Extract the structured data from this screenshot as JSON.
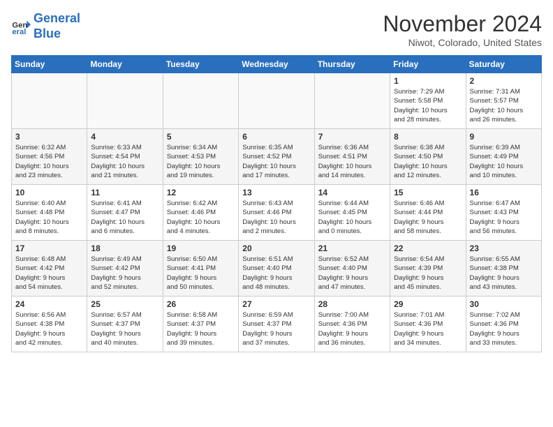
{
  "header": {
    "logo_line1": "General",
    "logo_line2": "Blue",
    "month": "November 2024",
    "location": "Niwot, Colorado, United States"
  },
  "weekdays": [
    "Sunday",
    "Monday",
    "Tuesday",
    "Wednesday",
    "Thursday",
    "Friday",
    "Saturday"
  ],
  "weeks": [
    [
      {
        "day": "",
        "info": ""
      },
      {
        "day": "",
        "info": ""
      },
      {
        "day": "",
        "info": ""
      },
      {
        "day": "",
        "info": ""
      },
      {
        "day": "",
        "info": ""
      },
      {
        "day": "1",
        "info": "Sunrise: 7:29 AM\nSunset: 5:58 PM\nDaylight: 10 hours\nand 28 minutes."
      },
      {
        "day": "2",
        "info": "Sunrise: 7:31 AM\nSunset: 5:57 PM\nDaylight: 10 hours\nand 26 minutes."
      }
    ],
    [
      {
        "day": "3",
        "info": "Sunrise: 6:32 AM\nSunset: 4:56 PM\nDaylight: 10 hours\nand 23 minutes."
      },
      {
        "day": "4",
        "info": "Sunrise: 6:33 AM\nSunset: 4:54 PM\nDaylight: 10 hours\nand 21 minutes."
      },
      {
        "day": "5",
        "info": "Sunrise: 6:34 AM\nSunset: 4:53 PM\nDaylight: 10 hours\nand 19 minutes."
      },
      {
        "day": "6",
        "info": "Sunrise: 6:35 AM\nSunset: 4:52 PM\nDaylight: 10 hours\nand 17 minutes."
      },
      {
        "day": "7",
        "info": "Sunrise: 6:36 AM\nSunset: 4:51 PM\nDaylight: 10 hours\nand 14 minutes."
      },
      {
        "day": "8",
        "info": "Sunrise: 6:38 AM\nSunset: 4:50 PM\nDaylight: 10 hours\nand 12 minutes."
      },
      {
        "day": "9",
        "info": "Sunrise: 6:39 AM\nSunset: 4:49 PM\nDaylight: 10 hours\nand 10 minutes."
      }
    ],
    [
      {
        "day": "10",
        "info": "Sunrise: 6:40 AM\nSunset: 4:48 PM\nDaylight: 10 hours\nand 8 minutes."
      },
      {
        "day": "11",
        "info": "Sunrise: 6:41 AM\nSunset: 4:47 PM\nDaylight: 10 hours\nand 6 minutes."
      },
      {
        "day": "12",
        "info": "Sunrise: 6:42 AM\nSunset: 4:46 PM\nDaylight: 10 hours\nand 4 minutes."
      },
      {
        "day": "13",
        "info": "Sunrise: 6:43 AM\nSunset: 4:46 PM\nDaylight: 10 hours\nand 2 minutes."
      },
      {
        "day": "14",
        "info": "Sunrise: 6:44 AM\nSunset: 4:45 PM\nDaylight: 10 hours\nand 0 minutes."
      },
      {
        "day": "15",
        "info": "Sunrise: 6:46 AM\nSunset: 4:44 PM\nDaylight: 9 hours\nand 58 minutes."
      },
      {
        "day": "16",
        "info": "Sunrise: 6:47 AM\nSunset: 4:43 PM\nDaylight: 9 hours\nand 56 minutes."
      }
    ],
    [
      {
        "day": "17",
        "info": "Sunrise: 6:48 AM\nSunset: 4:42 PM\nDaylight: 9 hours\nand 54 minutes."
      },
      {
        "day": "18",
        "info": "Sunrise: 6:49 AM\nSunset: 4:42 PM\nDaylight: 9 hours\nand 52 minutes."
      },
      {
        "day": "19",
        "info": "Sunrise: 6:50 AM\nSunset: 4:41 PM\nDaylight: 9 hours\nand 50 minutes."
      },
      {
        "day": "20",
        "info": "Sunrise: 6:51 AM\nSunset: 4:40 PM\nDaylight: 9 hours\nand 48 minutes."
      },
      {
        "day": "21",
        "info": "Sunrise: 6:52 AM\nSunset: 4:40 PM\nDaylight: 9 hours\nand 47 minutes."
      },
      {
        "day": "22",
        "info": "Sunrise: 6:54 AM\nSunset: 4:39 PM\nDaylight: 9 hours\nand 45 minutes."
      },
      {
        "day": "23",
        "info": "Sunrise: 6:55 AM\nSunset: 4:38 PM\nDaylight: 9 hours\nand 43 minutes."
      }
    ],
    [
      {
        "day": "24",
        "info": "Sunrise: 6:56 AM\nSunset: 4:38 PM\nDaylight: 9 hours\nand 42 minutes."
      },
      {
        "day": "25",
        "info": "Sunrise: 6:57 AM\nSunset: 4:37 PM\nDaylight: 9 hours\nand 40 minutes."
      },
      {
        "day": "26",
        "info": "Sunrise: 6:58 AM\nSunset: 4:37 PM\nDaylight: 9 hours\nand 39 minutes."
      },
      {
        "day": "27",
        "info": "Sunrise: 6:59 AM\nSunset: 4:37 PM\nDaylight: 9 hours\nand 37 minutes."
      },
      {
        "day": "28",
        "info": "Sunrise: 7:00 AM\nSunset: 4:36 PM\nDaylight: 9 hours\nand 36 minutes."
      },
      {
        "day": "29",
        "info": "Sunrise: 7:01 AM\nSunset: 4:36 PM\nDaylight: 9 hours\nand 34 minutes."
      },
      {
        "day": "30",
        "info": "Sunrise: 7:02 AM\nSunset: 4:36 PM\nDaylight: 9 hours\nand 33 minutes."
      }
    ]
  ]
}
